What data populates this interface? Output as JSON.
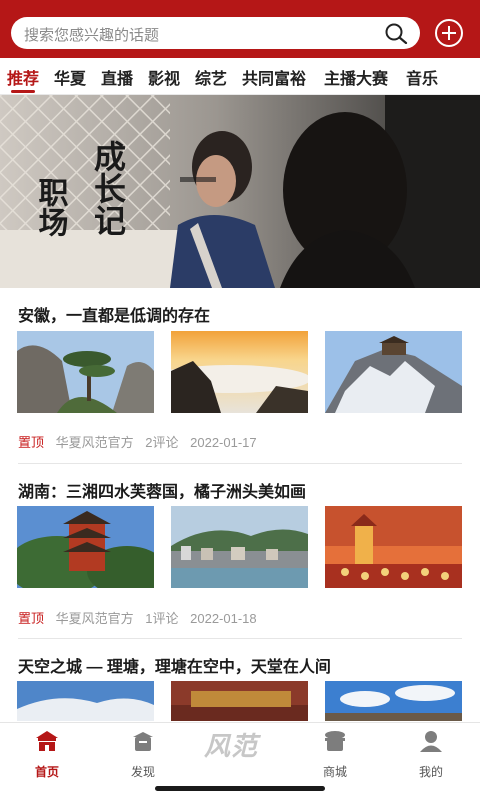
{
  "search": {
    "placeholder": "搜索您感兴趣的话题"
  },
  "tabs": [
    "推荐",
    "华夏",
    "直播",
    "影视",
    "综艺",
    "共同富裕",
    "主播大赛",
    "音乐"
  ],
  "banner": {
    "calligraphy_left": "职场",
    "calligraphy_right": "成长记"
  },
  "articles": [
    {
      "title": "安徽，一直都是低调的存在",
      "pin": "置顶",
      "author": "华夏风范官方",
      "comments": "2评论",
      "date": "2022-01-17"
    },
    {
      "title": "湖南：三湘四水芙蓉国，橘子洲头美如画",
      "pin": "置顶",
      "author": "华夏风范官方",
      "comments": "1评论",
      "date": "2022-01-18"
    },
    {
      "title": "天空之城 — 理塘，理塘在空中，天堂在人间"
    }
  ],
  "nav": {
    "home": "首页",
    "discover": "发现",
    "logo": "风范",
    "mall": "商城",
    "mine": "我的"
  },
  "colors": {
    "brand_red": "#b51717"
  }
}
